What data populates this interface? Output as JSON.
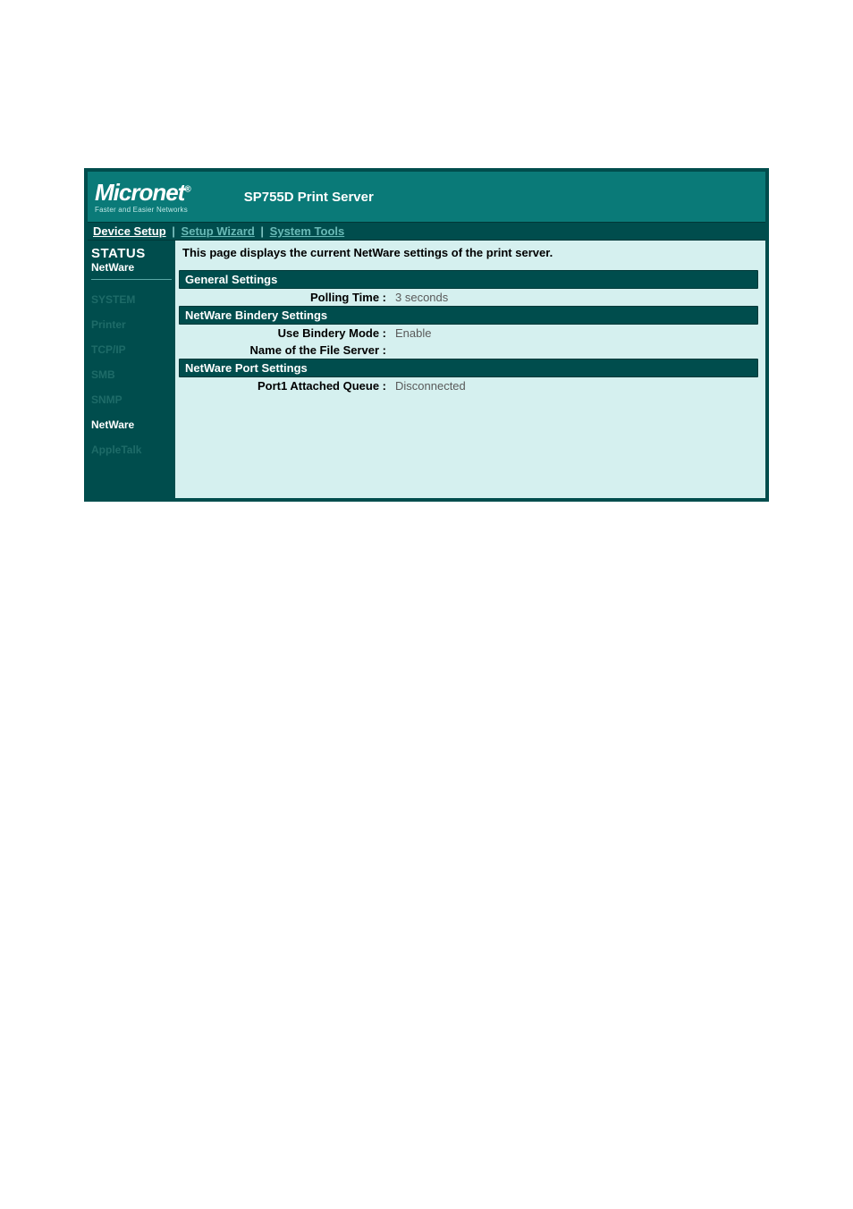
{
  "logo": {
    "brand": "Micronet",
    "reg": "®",
    "tagline": "Faster and Easier Networks"
  },
  "header": {
    "title": "SP755D Print Server"
  },
  "topnav": {
    "device_setup": "Device Setup",
    "setup_wizard": "Setup Wizard",
    "system_tools": "System Tools",
    "sep": "|"
  },
  "sidebar": {
    "status_title": "STATUS",
    "status_sub": "NetWare",
    "items": [
      {
        "label": "SYSTEM",
        "active": false
      },
      {
        "label": "Printer",
        "active": false
      },
      {
        "label": "TCP/IP",
        "active": false
      },
      {
        "label": "SMB",
        "active": false
      },
      {
        "label": "SNMP",
        "active": false
      },
      {
        "label": "NetWare",
        "active": true
      },
      {
        "label": "AppleTalk",
        "active": false
      }
    ]
  },
  "content": {
    "intro": "This page displays the current NetWare settings of the print server.",
    "sections": {
      "general_header": "General Settings",
      "polling_label": "Polling Time :",
      "polling_value": "3 seconds",
      "bindery_header": "NetWare Bindery Settings",
      "bindery_mode_label": "Use Bindery Mode :",
      "bindery_mode_value": "Enable",
      "fileserver_label": "Name of the File Server :",
      "fileserver_value": "",
      "port_header": "NetWare Port Settings",
      "port1_label": "Port1 Attached Queue :",
      "port1_value": "Disconnected"
    }
  }
}
